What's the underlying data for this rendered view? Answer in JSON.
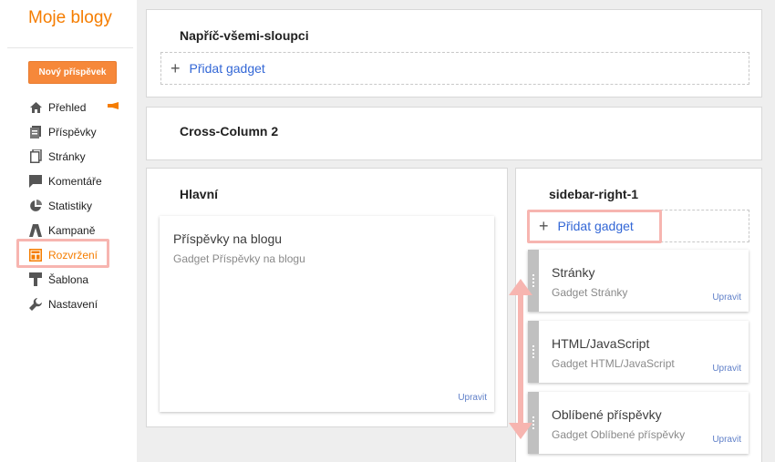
{
  "brand": "Moje blogy",
  "new_post": "Nový příspěvek",
  "nav": [
    {
      "label": "Přehled",
      "icon": "home-icon"
    },
    {
      "label": "Příspěvky",
      "icon": "posts-icon"
    },
    {
      "label": "Stránky",
      "icon": "pages-icon"
    },
    {
      "label": "Komentáře",
      "icon": "comments-icon"
    },
    {
      "label": "Statistiky",
      "icon": "stats-icon"
    },
    {
      "label": "Kampaně",
      "icon": "campaigns-icon"
    },
    {
      "label": "Rozvržení",
      "icon": "layout-icon"
    },
    {
      "label": "Šablona",
      "icon": "template-icon"
    },
    {
      "label": "Nastavení",
      "icon": "wrench-icon"
    }
  ],
  "active_nav": "Rozvržení",
  "sections": {
    "cross1": {
      "title": "Napříč-všemi-sloupci",
      "add": "Přidat gadget"
    },
    "cross2": {
      "title": "Cross-Column 2"
    },
    "main": {
      "title": "Hlavní",
      "gadget": {
        "title": "Příspěvky na blogu",
        "sub": "Gadget Příspěvky na blogu",
        "edit": "Upravit"
      }
    },
    "sidebar": {
      "title": "sidebar-right-1",
      "add": "Přidat gadget",
      "gadgets": [
        {
          "title": "Stránky",
          "sub": "Gadget Stránky",
          "edit": "Upravit"
        },
        {
          "title": "HTML/JavaScript",
          "sub": "Gadget HTML/JavaScript",
          "edit": "Upravit"
        },
        {
          "title": "Oblíbené příspěvky",
          "sub": "Gadget Oblíbené příspěvky",
          "edit": "Upravit"
        }
      ]
    }
  },
  "colors": {
    "accent": "#f57d00",
    "highlight": "#f7b5b0",
    "link": "#3367d6"
  }
}
